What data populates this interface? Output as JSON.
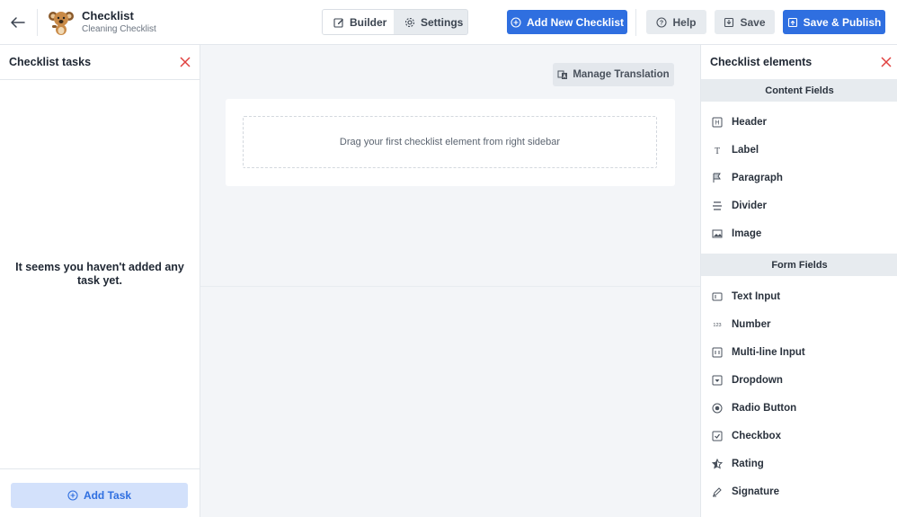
{
  "header": {
    "title": "Checklist",
    "subtitle": "Cleaning Checklist",
    "tabs": [
      {
        "label": "Builder",
        "icon": "edit-icon"
      },
      {
        "label": "Settings",
        "icon": "gear-icon"
      }
    ],
    "add_new_label": "Add New Checklist",
    "help_label": "Help",
    "save_label": "Save",
    "save_publish_label": "Save & Publish"
  },
  "left_sidebar": {
    "title": "Checklist tasks",
    "empty_message": "It seems you haven't added any task yet.",
    "add_task_label": "Add Task"
  },
  "main": {
    "manage_translation_label": "Manage Translation",
    "dropzone_text": "Drag your first checklist element from right sidebar"
  },
  "right_sidebar": {
    "title": "Checklist elements",
    "content_fields_title": "Content Fields",
    "content_fields": [
      {
        "label": "Header",
        "icon": "header-icon"
      },
      {
        "label": "Label",
        "icon": "text-icon"
      },
      {
        "label": "Paragraph",
        "icon": "paragraph-icon"
      },
      {
        "label": "Divider",
        "icon": "divider-icon"
      },
      {
        "label": "Image",
        "icon": "image-icon"
      }
    ],
    "form_fields_title": "Form Fields",
    "form_fields": [
      {
        "label": "Text Input",
        "icon": "text-input-icon"
      },
      {
        "label": "Number",
        "icon": "number-icon"
      },
      {
        "label": "Multi-line Input",
        "icon": "multiline-icon"
      },
      {
        "label": "Dropdown",
        "icon": "dropdown-icon"
      },
      {
        "label": "Radio Button",
        "icon": "radio-icon"
      },
      {
        "label": "Checkbox",
        "icon": "checkbox-icon"
      },
      {
        "label": "Rating",
        "icon": "star-icon"
      },
      {
        "label": "Signature",
        "icon": "signature-icon"
      }
    ]
  },
  "colors": {
    "primary": "#2f6fe0",
    "close": "#e0403f",
    "section_bg": "#e7ebef"
  }
}
